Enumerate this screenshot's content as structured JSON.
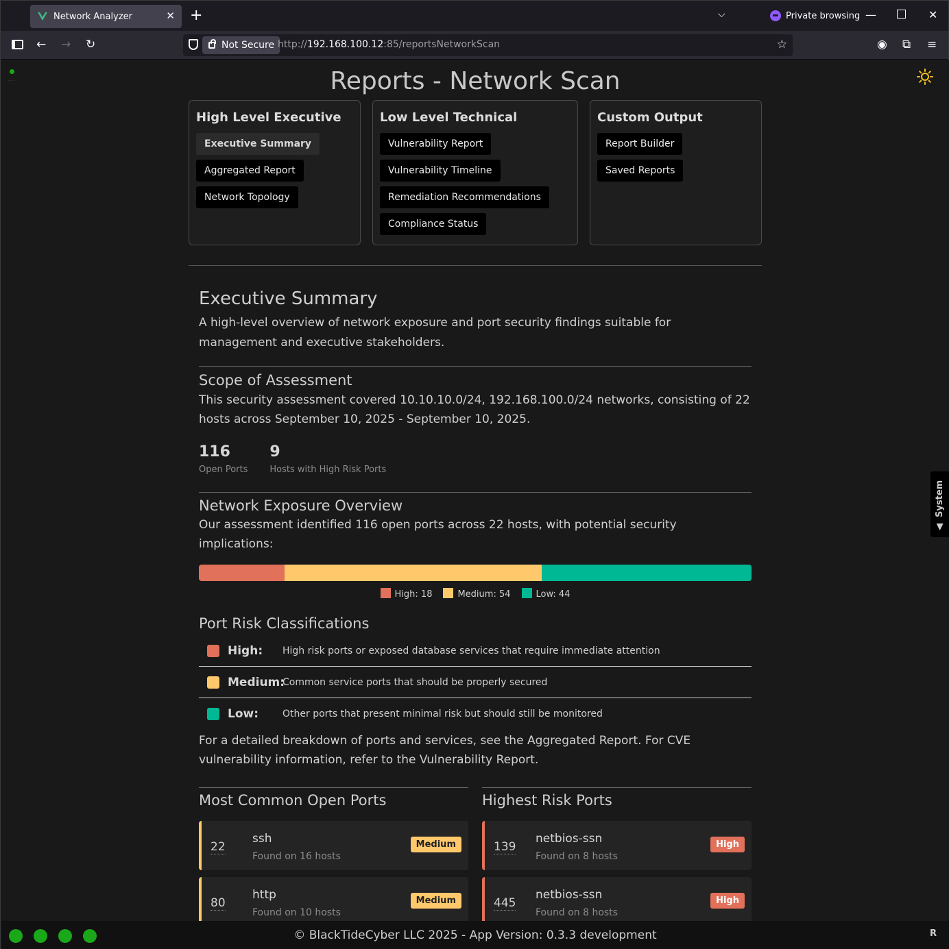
{
  "browser": {
    "tab_title": "Network Analyzer",
    "private_label": "Private browsing",
    "not_secure": "Not Secure",
    "url_prefix": "http://",
    "url_host": "192.168.100.12",
    "url_rest": ":85/reportsNetworkScan"
  },
  "page": {
    "title": "Reports - Network Scan",
    "theme_icon": "sun-icon",
    "system_tab": "System"
  },
  "nav_groups": [
    {
      "title": "High Level Executive",
      "items": [
        "Executive Summary",
        "Aggregated Report",
        "Network Topology"
      ],
      "active": "Executive Summary"
    },
    {
      "title": "Low Level Technical",
      "items": [
        "Vulnerability Report",
        "Vulnerability Timeline",
        "Remediation Recommendations",
        "Compliance Status"
      ]
    },
    {
      "title": "Custom Output",
      "items": [
        "Report Builder",
        "Saved Reports"
      ]
    }
  ],
  "summary": {
    "heading": "Executive Summary",
    "lead": "A high-level overview of network exposure and port security findings suitable for management and executive stakeholders.",
    "scope_heading": "Scope of Assessment",
    "scope_text": "This security assessment covered 10.10.10.0/24, 192.168.100.0/24 networks, consisting of 22 hosts across September 10, 2025 - September 10, 2025.",
    "stats": [
      {
        "value": "116",
        "label": "Open Ports"
      },
      {
        "value": "9",
        "label": "Hosts with High Risk Ports"
      }
    ],
    "exposure_heading": "Network Exposure Overview",
    "exposure_text": "Our assessment identified 116 open ports across 22 hosts, with potential security implications:",
    "risk_heading": "Port Risk Classifications",
    "detail_text": "For a detailed breakdown of ports and services, see the Aggregated Report. For CVE vulnerability information, refer to the Vulnerability Report."
  },
  "exposure": {
    "segments": [
      {
        "label": "High",
        "value": 18,
        "color": "#e1715a"
      },
      {
        "label": "Medium",
        "value": 54,
        "color": "#fec86b"
      },
      {
        "label": "Low",
        "value": 44,
        "color": "#00b894"
      }
    ],
    "legend": [
      "High: 18",
      "Medium: 54",
      "Low: 44"
    ]
  },
  "risk_classes": [
    {
      "label": "High:",
      "desc": "High risk ports or exposed database services that require immediate attention",
      "color": "#e1715a"
    },
    {
      "label": "Medium:",
      "desc": "Common service ports that should be properly secured",
      "color": "#fec86b"
    },
    {
      "label": "Low:",
      "desc": "Other ports that present minimal risk but should still be monitored",
      "color": "#00b894"
    }
  ],
  "common_ports": {
    "heading": "Most Common Open Ports",
    "items": [
      {
        "port": "22",
        "service": "ssh",
        "found": "Found on 16 hosts",
        "risk": "Medium"
      },
      {
        "port": "80",
        "service": "http",
        "found": "Found on 10 hosts",
        "risk": "Medium"
      }
    ]
  },
  "risk_ports": {
    "heading": "Highest Risk Ports",
    "items": [
      {
        "port": "139",
        "service": "netbios-ssn",
        "found": "Found on 8 hosts",
        "risk": "High"
      },
      {
        "port": "445",
        "service": "netbios-ssn",
        "found": "Found on 8 hosts",
        "risk": "High"
      }
    ]
  },
  "footer": {
    "copyright": "© BlackTideCyber LLC 2025 - App Version: 0.3.3 development",
    "badge": "R"
  }
}
